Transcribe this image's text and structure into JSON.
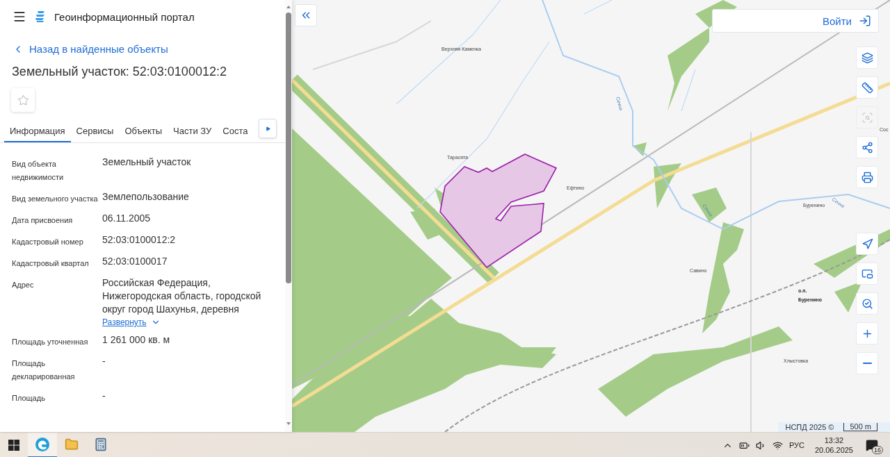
{
  "header": {
    "title": "Геоинформационный портал"
  },
  "back_link": "Назад в найденные объекты",
  "object_title": "Земельный участок: 52:03:0100012:2",
  "favorite": {
    "on": false
  },
  "tabs": [
    {
      "label": "Информация",
      "selected": true
    },
    {
      "label": "Сервисы",
      "selected": false
    },
    {
      "label": "Объекты",
      "selected": false
    },
    {
      "label": "Части ЗУ",
      "selected": false
    },
    {
      "label": "Соста",
      "selected": false
    }
  ],
  "properties": [
    {
      "label": "Вид объекта недвижимости",
      "value": "Земельный участок"
    },
    {
      "label": "Вид земельного участка",
      "value": "Землепользование"
    },
    {
      "label": "Дата присвоения",
      "value": "06.11.2005"
    },
    {
      "label": "Кадастровый номер",
      "value": "52:03:0100012:2"
    },
    {
      "label": "Кадастровый квартал",
      "value": "52:03:0100017"
    },
    {
      "label": "Адрес",
      "value": "Российская Федерация, Нижегородская область, городской округ город Шахунья, деревня",
      "expand_link": "Развернуть"
    },
    {
      "label": "Площадь уточненная",
      "value": "1 261 000 кв. м"
    },
    {
      "label": "Площадь декларированная",
      "value": "-"
    },
    {
      "label": "Площадь",
      "value": "-"
    }
  ],
  "map": {
    "labels": [
      {
        "text": "Верхняя Каменка",
        "kind": "place"
      },
      {
        "text": "Тарасята",
        "kind": "place"
      },
      {
        "text": "Ефтино",
        "kind": "place"
      },
      {
        "text": "Сос",
        "kind": "place"
      },
      {
        "text": "Буренино",
        "kind": "place"
      },
      {
        "text": "Савино",
        "kind": "place"
      },
      {
        "text": "о.п.",
        "kind": "station"
      },
      {
        "text": "Буренино",
        "kind": "station"
      },
      {
        "text": "Хлыстовка",
        "kind": "place"
      },
      {
        "text": "Сечна",
        "kind": "river"
      },
      {
        "text": "Сечна",
        "kind": "river"
      },
      {
        "text": "Сечна",
        "kind": "river"
      }
    ],
    "login_button": "Войти",
    "tools": [
      {
        "kind": "layers",
        "disabled": false
      },
      {
        "kind": "ruler",
        "disabled": false
      },
      {
        "kind": "select",
        "disabled": true
      },
      {
        "kind": "share",
        "disabled": false
      },
      {
        "kind": "print",
        "disabled": false
      },
      {
        "kind": "locate",
        "disabled": false
      },
      {
        "kind": "minimap",
        "disabled": false
      },
      {
        "kind": "geosearch",
        "disabled": false
      },
      {
        "kind": "zoom_in",
        "disabled": false
      },
      {
        "kind": "zoom_out",
        "disabled": false
      }
    ],
    "attribution": "НСПД 2025 ©",
    "scale": "500 m"
  },
  "taskbar": {
    "apps": [
      {
        "kind": "edge",
        "selected": true
      },
      {
        "kind": "explorer",
        "selected": false
      },
      {
        "kind": "calculator",
        "selected": false
      }
    ],
    "language": "РУС",
    "time": "13:32",
    "date": "20.06.2025",
    "notifications": "16"
  }
}
